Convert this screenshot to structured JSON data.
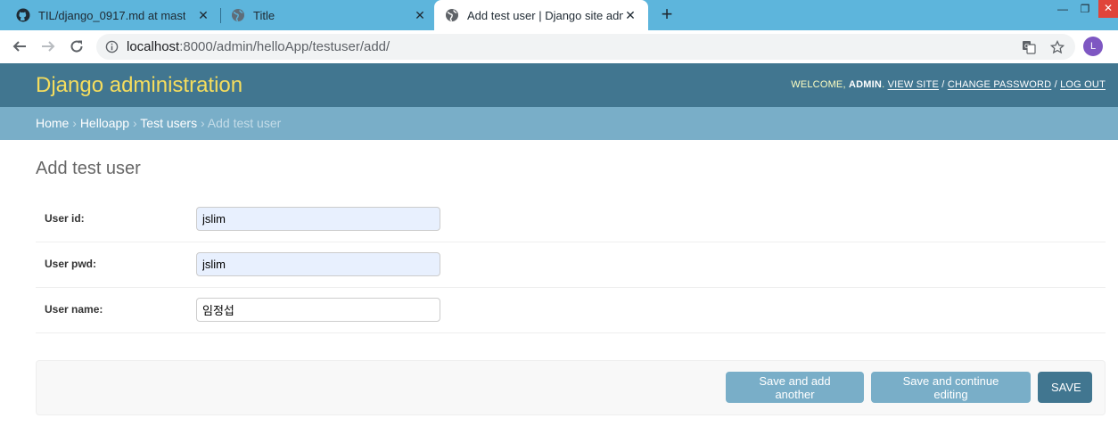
{
  "browser": {
    "tabs": [
      {
        "title": "TIL/django_0917.md at master · "
      },
      {
        "title": "Title"
      },
      {
        "title": "Add test user | Django site adm"
      }
    ],
    "url_host": "localhost",
    "url_path": ":8000/admin/helloApp/testuser/add/",
    "avatar_letter": "L"
  },
  "header": {
    "brand": "Django administration",
    "welcome": "WELCOME,",
    "username": "ADMIN",
    "view_site": "VIEW SITE",
    "change_password": "CHANGE PASSWORD",
    "log_out": "LOG OUT"
  },
  "breadcrumbs": {
    "home": "Home",
    "app": "Helloapp",
    "model": "Test users",
    "current": "Add test user"
  },
  "page": {
    "title": "Add test user"
  },
  "form": {
    "fields": [
      {
        "label": "User id:",
        "value": "jslim"
      },
      {
        "label": "User pwd:",
        "value": "jslim"
      },
      {
        "label": "User name:",
        "value": "임정섭"
      }
    ]
  },
  "buttons": {
    "save_add_another": "Save and add another",
    "save_continue": "Save and continue editing",
    "save": "SAVE"
  },
  "colors": {
    "header_bg": "#417690",
    "breadcrumb_bg": "#79aec8",
    "brand_text": "#f5dd5d",
    "tab_strip": "#5db5dc"
  }
}
